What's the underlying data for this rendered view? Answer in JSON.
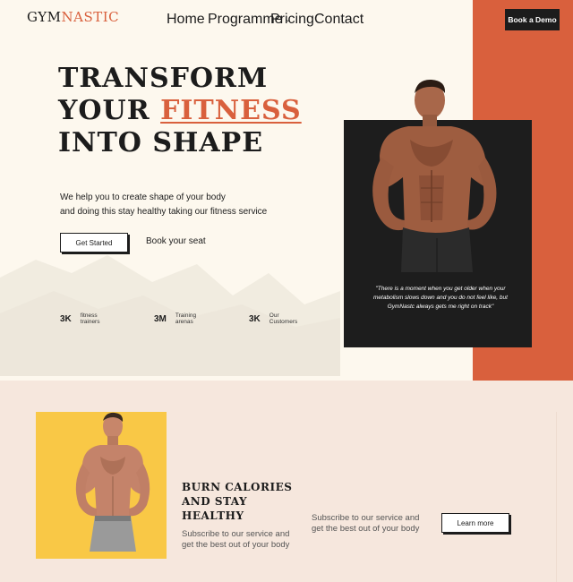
{
  "header": {
    "logo_part1": "GYM",
    "logo_part2": "NASTIC",
    "nav": [
      {
        "label": "Home"
      },
      {
        "label": "Programme",
        "has_dropdown": true
      },
      {
        "label": "Pricing"
      },
      {
        "label": "Contact"
      }
    ],
    "cta_label": "Book a Demo"
  },
  "hero": {
    "title_line1": "TRANSFORM",
    "title_line2_prefix": "YOUR ",
    "title_line2_accent": "FITNESS",
    "title_line3": "INTO SHAPE",
    "description_line1": "We help you to create shape of your body",
    "description_line2": "and doing this stay healthy taking our fitness service",
    "primary_button": "Get Started",
    "secondary_link": "Book your seat",
    "stats": [
      {
        "value": "3K",
        "label_line1": "fitness",
        "label_line2": "trainers"
      },
      {
        "value": "3M",
        "label_line1": "Training",
        "label_line2": "arenas"
      },
      {
        "value": "3K",
        "label_line1": "Our",
        "label_line2": "Customers"
      }
    ],
    "testimonial": "\"There is a moment when you get older when your metabolism slows down and you do not feel like, but GymNastc always gets me right on track\""
  },
  "promo": {
    "title_line1": "BURN CALORIES",
    "title_line2": "AND STAY",
    "title_line3": "HEALTHY",
    "subtitle_line1": "Subscribe to our service and",
    "subtitle_line2": "get the best out of your body",
    "side_text_line1": "Subscribe to our service and",
    "side_text_line2": "get the best out of your body",
    "button": "Learn more"
  },
  "colors": {
    "accent": "#d9603d",
    "background": "#fdf8ee",
    "dark": "#1c1c1c",
    "section_bg": "#f6e7dd",
    "card_yellow": "#f9c846"
  },
  "icons": {
    "dropdown": "chevron-down-icon"
  }
}
